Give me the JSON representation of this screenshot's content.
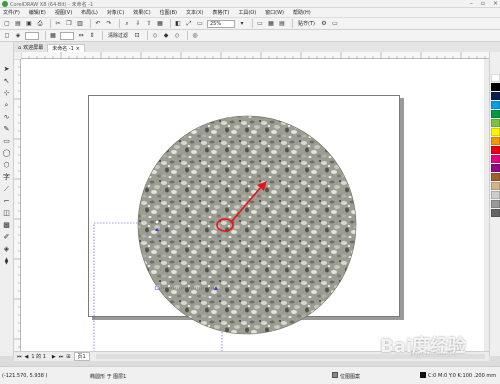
{
  "title_bar": {
    "title": "CorelDRAW X8 (64-Bit) - 未命名 -1",
    "min_icon": "minimize-icon",
    "max_icon": "maximize-icon",
    "close_icon": "close-icon"
  },
  "menu": {
    "items": [
      "文件(F)",
      "编辑(E)",
      "视图(V)",
      "布局(L)",
      "对象(C)",
      "效果(C)",
      "位图(B)",
      "文本(X)",
      "表格(T)",
      "工具(O)",
      "窗口(W)",
      "帮助(H)"
    ]
  },
  "toolbar": {
    "zoom_value": "25%",
    "snap_label": "贴齐(T)",
    "align_label": "清除过滤"
  },
  "tabs": {
    "welcome": "欢迎屏幕",
    "document": "未命名 -1"
  },
  "page_nav": {
    "page_count": "1 的 1",
    "page_tab": "页1"
  },
  "status": {
    "coordinates": "(-121.570, 5.938 )",
    "layer_info": "椭圆形 于 图层1",
    "fill_label": "位图图案",
    "outline_label": "C:0 M:0 Y:0 K:100 .200 mm"
  },
  "watermark": {
    "text": "Bai度经验",
    "url": "jingyan.baidu.com"
  },
  "colors": {
    "arrow": "#e8141b",
    "palette": [
      "#ffffff",
      "#000000",
      "#0b1e4e",
      "#00a0e9",
      "#009a44",
      "#7fc241",
      "#fff200",
      "#f39800",
      "#e60012",
      "#e4007f",
      "#920783",
      "#a05f2c",
      "#d2b48c",
      "#cccccc",
      "#999999",
      "#666666"
    ]
  }
}
